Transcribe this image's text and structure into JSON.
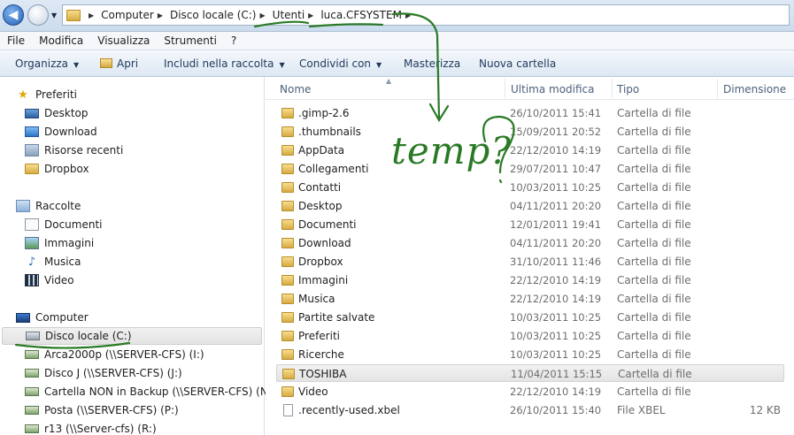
{
  "breadcrumb": {
    "items": [
      "Computer",
      "Disco locale (C:)",
      "Utenti",
      "luca.CFSYSTEM"
    ]
  },
  "menu": {
    "items": [
      "File",
      "Modifica",
      "Visualizza",
      "Strumenti",
      "?"
    ]
  },
  "toolbar": {
    "organize": "Organizza",
    "open": "Apri",
    "include": "Includi nella raccolta",
    "share": "Condividi con",
    "burn": "Masterizza",
    "new_folder": "Nuova cartella"
  },
  "nav": {
    "favorites_label": "Preferiti",
    "favorites": [
      {
        "label": "Desktop",
        "icon": "desktop-icon"
      },
      {
        "label": "Download",
        "icon": "download-icon"
      },
      {
        "label": "Risorse recenti",
        "icon": "recent-places-icon"
      },
      {
        "label": "Dropbox",
        "icon": "dropbox-icon"
      }
    ],
    "libraries_label": "Raccolte",
    "libraries": [
      {
        "label": "Documenti",
        "icon": "documents-icon"
      },
      {
        "label": "Immagini",
        "icon": "pictures-icon"
      },
      {
        "label": "Musica",
        "icon": "music-icon"
      },
      {
        "label": "Video",
        "icon": "video-icon"
      }
    ],
    "computer_label": "Computer",
    "drives": [
      {
        "label": "Disco locale (C:)",
        "icon": "local-disk-icon",
        "selected": true
      },
      {
        "label": "Arca2000p (\\\\SERVER-CFS) (I:)",
        "icon": "network-drive-icon"
      },
      {
        "label": "Disco J (\\\\SERVER-CFS) (J:)",
        "icon": "network-drive-icon"
      },
      {
        "label": "Cartella NON in Backup (\\\\SERVER-CFS) (N:)",
        "icon": "network-drive-icon"
      },
      {
        "label": "Posta (\\\\SERVER-CFS) (P:)",
        "icon": "network-drive-icon"
      },
      {
        "label": "r13 (\\\\Server-cfs) (R:)",
        "icon": "network-drive-icon"
      }
    ]
  },
  "columns": {
    "name": "Nome",
    "modified": "Ultima modifica",
    "type": "Tipo",
    "size": "Dimensione"
  },
  "files": [
    {
      "name": ".gimp-2.6",
      "modified": "26/10/2011 15:41",
      "type": "Cartella di file",
      "size": ""
    },
    {
      "name": ".thumbnails",
      "modified": "15/09/2011 20:52",
      "type": "Cartella di file",
      "size": ""
    },
    {
      "name": "AppData",
      "modified": "22/12/2010 14:19",
      "type": "Cartella di file",
      "size": ""
    },
    {
      "name": "Collegamenti",
      "modified": "29/07/2011 10:47",
      "type": "Cartella di file",
      "size": ""
    },
    {
      "name": "Contatti",
      "modified": "10/03/2011 10:25",
      "type": "Cartella di file",
      "size": ""
    },
    {
      "name": "Desktop",
      "modified": "04/11/2011 20:20",
      "type": "Cartella di file",
      "size": ""
    },
    {
      "name": "Documenti",
      "modified": "12/01/2011 19:41",
      "type": "Cartella di file",
      "size": ""
    },
    {
      "name": "Download",
      "modified": "04/11/2011 20:20",
      "type": "Cartella di file",
      "size": ""
    },
    {
      "name": "Dropbox",
      "modified": "31/10/2011 11:46",
      "type": "Cartella di file",
      "size": ""
    },
    {
      "name": "Immagini",
      "modified": "22/12/2010 14:19",
      "type": "Cartella di file",
      "size": ""
    },
    {
      "name": "Musica",
      "modified": "22/12/2010 14:19",
      "type": "Cartella di file",
      "size": ""
    },
    {
      "name": "Partite salvate",
      "modified": "10/03/2011 10:25",
      "type": "Cartella di file",
      "size": ""
    },
    {
      "name": "Preferiti",
      "modified": "10/03/2011 10:25",
      "type": "Cartella di file",
      "size": ""
    },
    {
      "name": "Ricerche",
      "modified": "10/03/2011 10:25",
      "type": "Cartella di file",
      "size": ""
    },
    {
      "name": "TOSHIBA",
      "modified": "11/04/2011 15:15",
      "type": "Cartella di file",
      "size": "",
      "selected": true
    },
    {
      "name": "Video",
      "modified": "22/12/2010 14:19",
      "type": "Cartella di file",
      "size": ""
    },
    {
      "name": ".recently-used.xbel",
      "modified": "26/10/2011 15:40",
      "type": "File XBEL",
      "size": "12 KB",
      "is_file": true
    }
  ],
  "annotation": {
    "text": "temp?",
    "color": "#2a7a25"
  }
}
